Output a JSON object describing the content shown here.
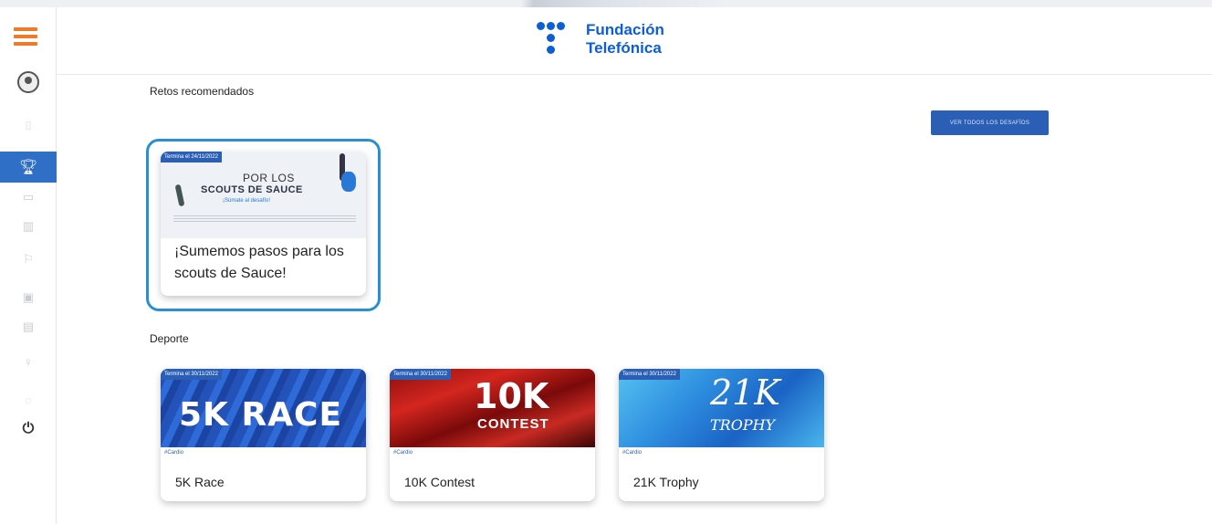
{
  "header": {
    "brand_line1": "Fundación",
    "brand_line2": "Telefónica"
  },
  "recommended": {
    "title": "Retos recomendados",
    "all_challenges_button": "VER TODOS LOS DESAFÍOS",
    "card": {
      "end_tag": "Termina el 24/11/2022",
      "image_line1": "POR LOS",
      "image_line2": "SCOUTS DE SAUCE",
      "image_line3": "¡Súmate al desafío!",
      "title": "¡Sumemos pasos para los scouts de Sauce!"
    }
  },
  "sport": {
    "title": "Deporte",
    "cards": [
      {
        "end_tag": "Termina el 30/11/2022",
        "image_text": "5K RACE",
        "category": "#Cardio",
        "title": "5K Race"
      },
      {
        "end_tag": "Termina el 30/11/2022",
        "image_text": "10K",
        "image_subtext": "CONTEST",
        "category": "#Cardio",
        "title": "10K Contest"
      },
      {
        "end_tag": "Termina el 30/11/2022",
        "image_text": "21K",
        "image_subtext": "TROPHY",
        "category": "#Cardio",
        "title": "21K Trophy"
      }
    ]
  },
  "sidebar": {
    "items": [
      "menu-icon",
      "profile-icon",
      "challenges-icon",
      "chat-icon",
      "stats-icon",
      "rewards-icon",
      "calendar-icon",
      "team-icon",
      "award-icon",
      "settings-icon",
      "power-icon"
    ]
  },
  "colors": {
    "accent": "#2a5fb5",
    "brand": "#0c5ed6",
    "menu": "#f07a2a",
    "highlight": "#2a8fd1"
  }
}
